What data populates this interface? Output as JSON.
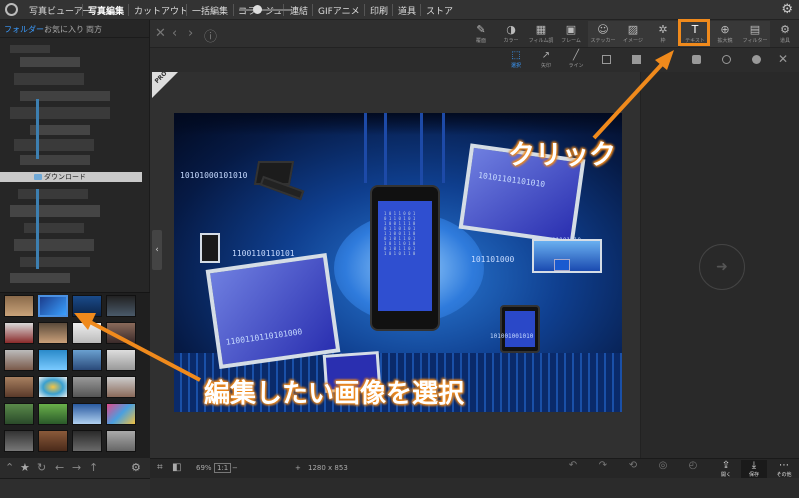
{
  "menubar": {
    "items": [
      "写真ビューアー",
      "写真編集",
      "カットアウト",
      "一括編集",
      "コラージュ",
      "連結",
      "GIFアニメ",
      "印刷",
      "道具",
      "ストア"
    ],
    "active_index": 1
  },
  "sidebar": {
    "tabs": [
      "フォルダー",
      "お気に入り",
      "両方"
    ],
    "selected_folder": "ダウンロード"
  },
  "toolbar": {
    "tools": [
      "覆面",
      "カラー",
      "フィルム調",
      "フレーム",
      "ステッカー",
      "イメージ",
      "枠",
      "テキスト",
      "拡大鏡",
      "フィルター",
      "道具"
    ],
    "highlighted_tool": "テキスト"
  },
  "subtoolbar": {
    "tools": [
      "選択",
      "矢印",
      "ライン"
    ],
    "active": "選択"
  },
  "pro_badge": "PRO",
  "photo": {
    "binary_texts": [
      "10101000101010",
      "10101101101010",
      "1100110110101",
      "1100110110101000",
      "101101000",
      "1010101101010",
      "101001001010"
    ]
  },
  "statusbar": {
    "zoom_percent": "69%",
    "fit_label": "1:1",
    "zoom_slider_fraction": 0.35,
    "dimensions": "1280 x 853",
    "buttons": [
      "開く",
      "保存",
      "その他"
    ]
  },
  "annotations": {
    "click_label": "クリック",
    "select_label": "編集したい画像を選択",
    "color": "#f08a1c"
  }
}
